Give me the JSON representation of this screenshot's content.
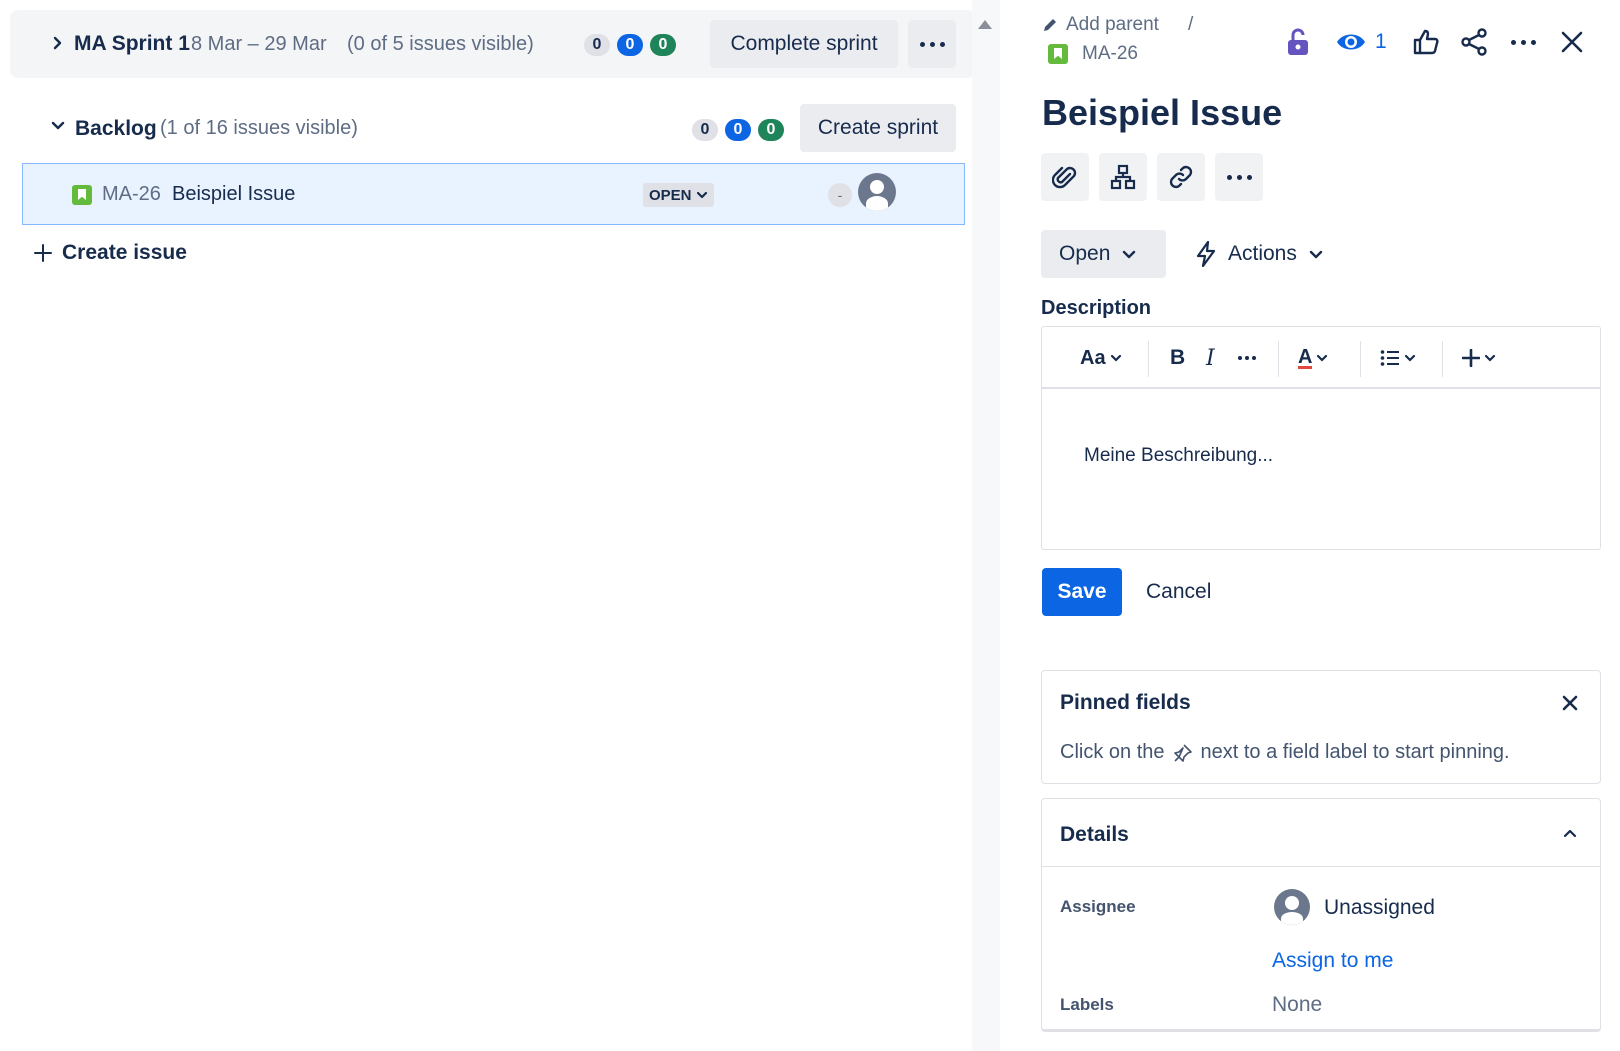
{
  "sprint": {
    "name": "MA Sprint 1",
    "dates": "8 Mar – 29 Mar",
    "visibility": "(0 of 5 issues visible)",
    "counts": {
      "todo": "0",
      "in_progress": "0",
      "done": "0"
    },
    "complete_label": "Complete sprint"
  },
  "backlog": {
    "name": "Backlog",
    "visibility": "(1 of 16 issues visible)",
    "counts": {
      "todo": "0",
      "in_progress": "0",
      "done": "0"
    },
    "create_sprint_label": "Create sprint",
    "issues": [
      {
        "key": "MA-26",
        "summary": "Beispiel Issue",
        "status": "OPEN",
        "estimate": "-"
      }
    ],
    "create_issue_label": "Create issue"
  },
  "detail": {
    "add_parent_label": "Add parent",
    "breadcrumb_separator": "/",
    "issue_key": "MA-26",
    "watchers_count": "1",
    "title": "Beispiel Issue",
    "status_label": "Open",
    "actions_label": "Actions",
    "description_label": "Description",
    "editor": {
      "text_style_label": "Aa",
      "bold_label": "B",
      "italic_label": "I",
      "color_label": "A",
      "content": "Meine Beschreibung..."
    },
    "save_label": "Save",
    "cancel_label": "Cancel",
    "pinned": {
      "title": "Pinned fields",
      "hint_before": "Click on the",
      "hint_after": "next to a field label to start pinning."
    },
    "details": {
      "title": "Details",
      "assignee_label": "Assignee",
      "assignee_value": "Unassigned",
      "assign_to_me": "Assign to me",
      "labels_label": "Labels",
      "labels_value": "None"
    }
  },
  "colors": {
    "brand_blue": "#0c66e4",
    "done_green": "#1f845a",
    "story_green": "#63ba3c",
    "selected_row_bg": "#e9f2ff"
  }
}
